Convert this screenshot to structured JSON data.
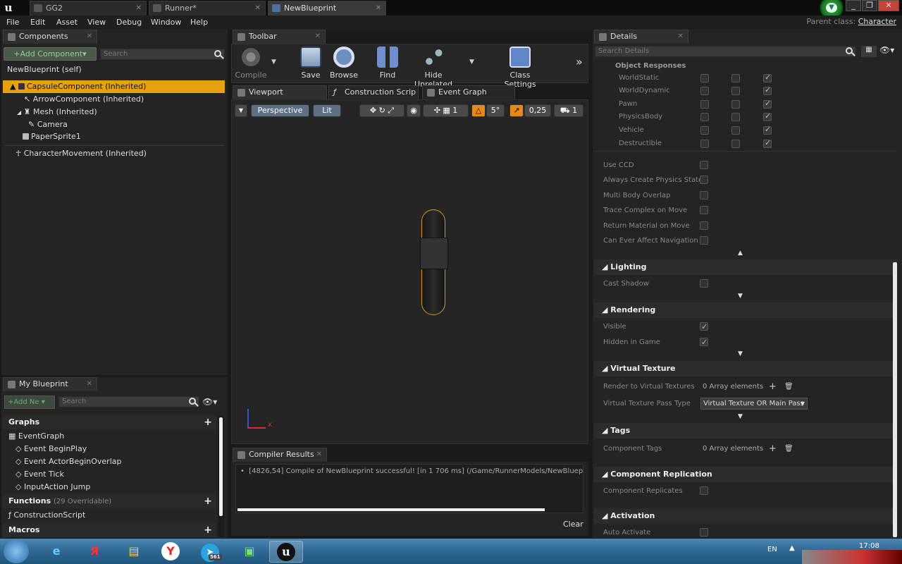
{
  "titlebar": {
    "tabs": [
      {
        "label": "GG2"
      },
      {
        "label": "Runner*"
      },
      {
        "label": "NewBlueprint"
      }
    ],
    "window_buttons": [
      "_",
      "❐",
      "✕"
    ],
    "parent_class_label": "Parent class:",
    "parent_class_value": "Character"
  },
  "menubar": {
    "items": [
      "File",
      "Edit",
      "Asset",
      "View",
      "Debug",
      "Window",
      "Help"
    ]
  },
  "components": {
    "tab": "Components",
    "add_button": "+Add Component",
    "search_placeholder": "Search",
    "items": [
      "NewBlueprint (self)",
      "CapsuleComponent (Inherited)",
      "ArrowComponent (Inherited)",
      "Mesh (Inherited)",
      "Camera",
      "PaperSprite1",
      "CharacterMovement (Inherited)"
    ]
  },
  "my_blueprint": {
    "tab": "My Blueprint",
    "add_button": "+Add Ne",
    "search_placeholder": "Search",
    "graphs_header": "Graphs",
    "graphs": [
      "EventGraph",
      "Event BeginPlay",
      "Event ActorBeginOverlap",
      "Event Tick",
      "InputAction Jump"
    ],
    "functions_header": "Functions",
    "functions_count": "(29 Overridable)",
    "functions": [
      "ConstructionScript"
    ],
    "macros_header": "Macros"
  },
  "toolbar": {
    "tab": "Toolbar",
    "buttons": [
      "Compile",
      "Save",
      "Browse",
      "Find",
      "Hide Unrelated",
      "Class Settings"
    ]
  },
  "editor_tabs": [
    "Viewport",
    "Construction Scrip",
    "Event Graph"
  ],
  "viewport": {
    "perspective": "Perspective",
    "lit": "Lit",
    "snap_angle": "5°",
    "snap_scale": "0,25",
    "cam_speed": "1",
    "grid_count": "1",
    "axis_x": "x"
  },
  "compiler": {
    "tab": "Compiler Results",
    "message": "[4826,54] Compile of NewBlueprint successful! [in 1 706 ms] (/Game/RunnerModels/NewBlueprint.N",
    "clear": "Clear"
  },
  "details": {
    "tab": "Details",
    "search_placeholder": "Search Details",
    "object_responses": "Object Responses",
    "responses": [
      "WorldStatic",
      "WorldDynamic",
      "Pawn",
      "PhysicsBody",
      "Vehicle",
      "Destructible"
    ],
    "collision_props": [
      "Use CCD",
      "Always Create Physics State",
      "Multi Body Overlap",
      "Trace Complex on Move",
      "Return Material on Move",
      "Can Ever Affect Navigation"
    ],
    "lighting": "Lighting",
    "cast_shadow": "Cast Shadow",
    "rendering": "Rendering",
    "visible": "Visible",
    "hidden_in_game": "Hidden in Game",
    "virtual_texture": "Virtual Texture",
    "render_to_vt": "Render to Virtual Textures",
    "array_elements": "0 Array elements",
    "vt_pass_type": "Virtual Texture Pass Type",
    "vt_pass_value": "Virtual Texture OR Main Pass",
    "tags": "Tags",
    "component_tags": "Component Tags",
    "component_replication": "Component Replication",
    "component_replicates": "Component Replicates",
    "activation": "Activation",
    "auto_activate": "Auto Activate"
  },
  "taskbar": {
    "lang": "EN",
    "time": "17:08",
    "telegram_badge": "561"
  }
}
